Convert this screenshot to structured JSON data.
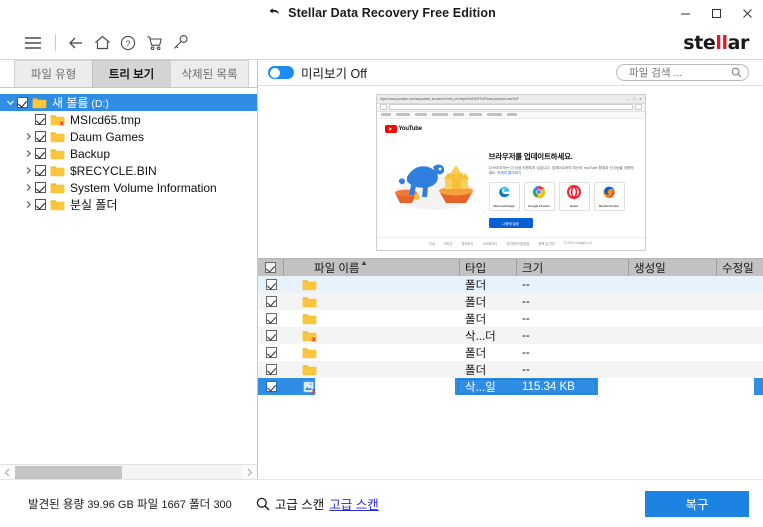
{
  "window": {
    "title": "Stellar Data Recovery Free Edition",
    "icon": "recovery-arrow-icon",
    "minimize": "–",
    "maximize": "□",
    "close": "×"
  },
  "toolbar": {
    "icons": [
      {
        "name": "hamburger-menu-icon",
        "label": "Menu"
      },
      {
        "name": "back-arrow-icon",
        "label": "Back"
      },
      {
        "name": "home-icon",
        "label": "Home"
      },
      {
        "name": "help-icon",
        "label": "Help"
      },
      {
        "name": "cart-icon",
        "label": "Buy"
      },
      {
        "name": "key-icon",
        "label": "Activate"
      }
    ],
    "brand_part1": "ste",
    "brand_accent": "ll",
    "brand_part2": "ar",
    "brand_accent_color": "#e01b24"
  },
  "left_panel": {
    "tabs": [
      {
        "label": "파일 유형",
        "active": false
      },
      {
        "label": "트리 보기",
        "active": true
      },
      {
        "label": "삭제된 목록",
        "active": false
      }
    ],
    "tree": [
      {
        "label": "새 볼륨",
        "sub": " (D:)",
        "indent": 0,
        "arrow": "down",
        "checked": true,
        "icon": "folder-icon",
        "selected": true
      },
      {
        "label": "MSIcd65.tmp",
        "sub": "",
        "indent": 1,
        "arrow": "none",
        "checked": true,
        "icon": "folder-deleted-icon",
        "selected": false
      },
      {
        "label": "Daum Games",
        "sub": "",
        "indent": 1,
        "arrow": "right",
        "checked": true,
        "icon": "folder-icon",
        "selected": false
      },
      {
        "label": "Backup",
        "sub": "",
        "indent": 1,
        "arrow": "right",
        "checked": true,
        "icon": "folder-icon",
        "selected": false
      },
      {
        "label": "$RECYCLE.BIN",
        "sub": "",
        "indent": 1,
        "arrow": "right",
        "checked": true,
        "icon": "folder-icon",
        "selected": false
      },
      {
        "label": "System Volume Information",
        "sub": "",
        "indent": 1,
        "arrow": "right",
        "checked": true,
        "icon": "folder-icon",
        "selected": false
      },
      {
        "label": "분실 폴더",
        "sub": "",
        "indent": 1,
        "arrow": "right",
        "checked": true,
        "icon": "folder-icon",
        "selected": false
      }
    ]
  },
  "right_panel": {
    "preview_toggle": {
      "label": "미리보기 Off",
      "on": true
    },
    "search": {
      "placeholder": "파일 검색 ...",
      "value": "",
      "icon": "search-icon"
    }
  },
  "preview": {
    "browser_url": "https://www.youtube.com/supported_browsers?next_url=https%3A%2F%2Fwww.youtube.com%2F",
    "site_logo": "YouTube",
    "heading": "브라우저를 업데이트하세요.",
    "paragraph": "이 브라우저는 더 이상 지원되지 않습니다. 업데이트하여 최신의 YouTube 환경과 신기능을 이용하세요.",
    "paragraph_link": "자세히 알아보기",
    "browsers": [
      {
        "name": "Microsoft Edge",
        "icon": "edge-icon"
      },
      {
        "name": "Google Chrome",
        "icon": "chrome-icon"
      },
      {
        "name": "Opera",
        "icon": "opera-icon"
      },
      {
        "name": "Mozilla Firefox",
        "icon": "firefox-icon"
      }
    ],
    "cta": "나중에 설정",
    "footer_links": [
      "안내",
      "저작권",
      "문의하기",
      "크리에이터",
      "개인정보처리방침",
      "정책 및 안전",
      "© 2021 Google LLC"
    ]
  },
  "table": {
    "columns": [
      {
        "key": "check",
        "label": "",
        "header_checkbox": true
      },
      {
        "key": "name",
        "label": "파일 이름",
        "sorted": "asc"
      },
      {
        "key": "type",
        "label": "타입"
      },
      {
        "key": "size",
        "label": "크기"
      },
      {
        "key": "created",
        "label": "생성일"
      },
      {
        "key": "modified",
        "label": "수정일"
      }
    ],
    "rows": [
      {
        "checked": true,
        "icon": "folder-icon",
        "name": "",
        "type": "폴더",
        "size": "--",
        "created": "",
        "modified": "",
        "selected": false
      },
      {
        "checked": true,
        "icon": "folder-icon",
        "name": "",
        "type": "폴더",
        "size": "--",
        "created": "",
        "modified": "",
        "selected": false
      },
      {
        "checked": true,
        "icon": "folder-icon",
        "name": "",
        "type": "폴더",
        "size": "--",
        "created": "",
        "modified": "",
        "selected": false
      },
      {
        "checked": true,
        "icon": "folder-deleted-icon",
        "name": "",
        "type": "삭...더",
        "size": "--",
        "created": "",
        "modified": "",
        "selected": false
      },
      {
        "checked": true,
        "icon": "folder-icon",
        "name": "",
        "type": "폴더",
        "size": "--",
        "created": "",
        "modified": "",
        "selected": false
      },
      {
        "checked": true,
        "icon": "folder-icon",
        "name": "",
        "type": "폴더",
        "size": "--",
        "created": "",
        "modified": "",
        "selected": false
      },
      {
        "checked": true,
        "icon": "file-deleted-icon",
        "name": "",
        "type": "삭...일",
        "size": "115.34 KB",
        "created": "",
        "modified": "",
        "selected": true
      }
    ]
  },
  "statusbar": {
    "found_label": "발견된 용량",
    "found_value": "39.96 GB",
    "files_label": "파일",
    "files_value": "1667",
    "folders_label": "폴더",
    "folders_value": "300",
    "advanced_icon": "search-icon",
    "advanced_label": "고급 스캔",
    "advanced_link": "고급 스캔",
    "recover_button": "복구",
    "recover_color": "#1d83e2"
  }
}
